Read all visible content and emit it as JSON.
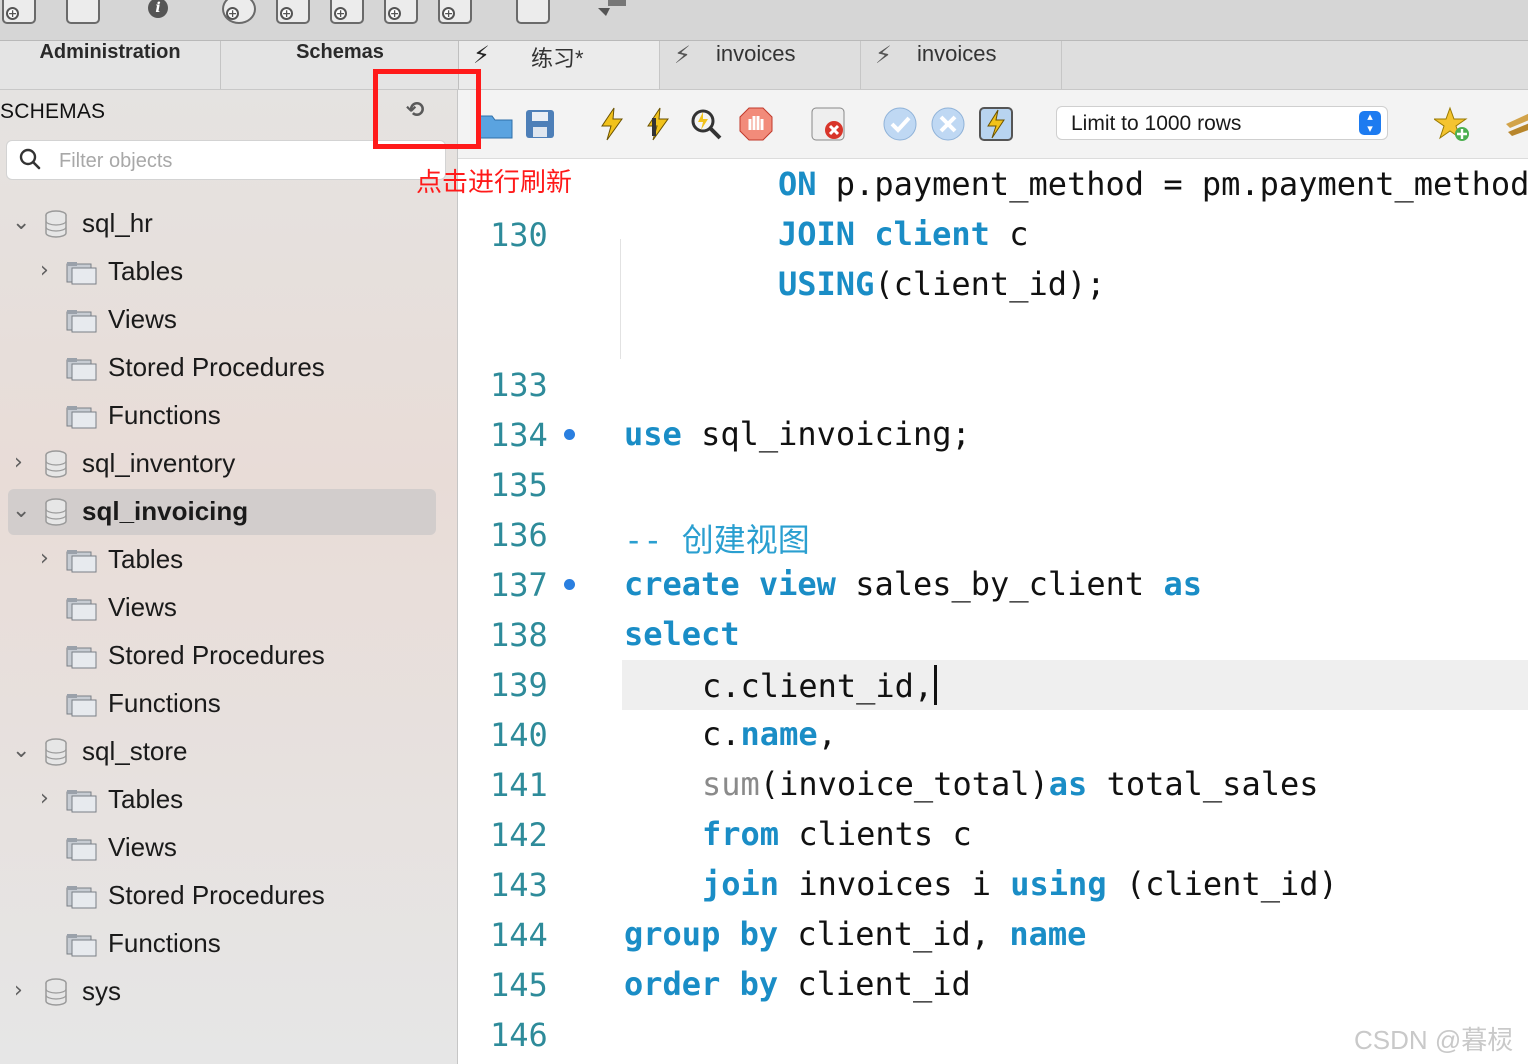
{
  "top_toolbar": {
    "icons": [
      "new-sql-tab-icon",
      "open-sql-file-icon",
      "inspector-info-icon",
      "create-schema-icon",
      "create-table-icon",
      "create-view-icon",
      "create-procedure-icon",
      "create-function-icon",
      "search-table-data-icon",
      "reconnect-icon"
    ]
  },
  "left_tabs": {
    "administration": "Administration",
    "schemas": "Schemas"
  },
  "doc_tabs": [
    {
      "label": "练习*",
      "active": true
    },
    {
      "label": "invoices",
      "active": false
    },
    {
      "label": "invoices",
      "active": false
    }
  ],
  "sidebar": {
    "header": "SCHEMAS",
    "filter_placeholder": "Filter objects",
    "tree": [
      {
        "label": "sql_hr",
        "type": "schema",
        "expanded": true
      },
      {
        "label": "Tables",
        "type": "folder",
        "expandable": true
      },
      {
        "label": "Views",
        "type": "folder"
      },
      {
        "label": "Stored Procedures",
        "type": "folder"
      },
      {
        "label": "Functions",
        "type": "folder"
      },
      {
        "label": "sql_inventory",
        "type": "schema",
        "expanded": false
      },
      {
        "label": "sql_invoicing",
        "type": "schema",
        "expanded": true,
        "selected": true
      },
      {
        "label": "Tables",
        "type": "folder",
        "expandable": true
      },
      {
        "label": "Views",
        "type": "folder"
      },
      {
        "label": "Stored Procedures",
        "type": "folder"
      },
      {
        "label": "Functions",
        "type": "folder"
      },
      {
        "label": "sql_store",
        "type": "schema",
        "expanded": true
      },
      {
        "label": "Tables",
        "type": "folder",
        "expandable": true
      },
      {
        "label": "Views",
        "type": "folder"
      },
      {
        "label": "Stored Procedures",
        "type": "folder"
      },
      {
        "label": "Functions",
        "type": "folder"
      },
      {
        "label": "sys",
        "type": "schema",
        "expanded": false
      }
    ]
  },
  "editor_toolbar": {
    "limit_rows": "Limit to 1000 rows"
  },
  "editor": {
    "lines": [
      {
        "num": "",
        "code": "ON p.payment_method = pm.payment_method"
      },
      {
        "num": "130",
        "code": "JOIN client c"
      },
      {
        "num": "",
        "code": "USING(client_id);"
      },
      {
        "num": "133",
        "code": ""
      },
      {
        "num": "134",
        "code": "use sql_invoicing;",
        "dot": true
      },
      {
        "num": "135",
        "code": ""
      },
      {
        "num": "136",
        "code": "-- 创建视图"
      },
      {
        "num": "137",
        "code": "create view sales_by_client as",
        "dot": true
      },
      {
        "num": "138",
        "code": "select"
      },
      {
        "num": "139",
        "code": "c.client_id,",
        "current": true
      },
      {
        "num": "140",
        "code": "c.name,"
      },
      {
        "num": "141",
        "code": "sum(invoice_total)as total_sales"
      },
      {
        "num": "142",
        "code": "from clients c"
      },
      {
        "num": "143",
        "code": "join invoices i using (client_id)"
      },
      {
        "num": "144",
        "code": "group by client_id, name"
      },
      {
        "num": "145",
        "code": "order by client_id"
      },
      {
        "num": "146",
        "code": ""
      }
    ]
  },
  "annotation": {
    "text": "点击进行刷新",
    "color": "#ff1a1a"
  },
  "watermark": "CSDN @暮棂",
  "colors": {
    "keyword": "#1a8dc6",
    "line_number": "#2e8b9a",
    "highlight": "#efefef",
    "selection": "#d2cdcc"
  }
}
